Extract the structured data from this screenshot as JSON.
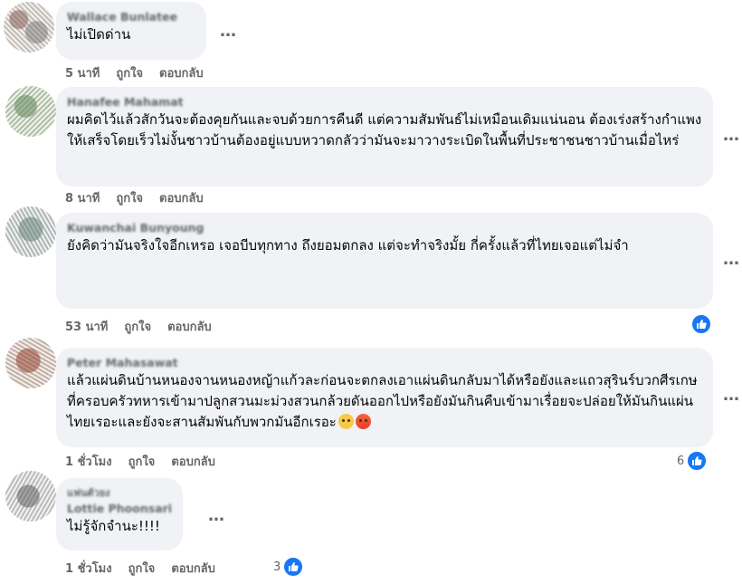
{
  "comments": [
    {
      "author": "Wallace Bunlatee",
      "text": "ไม่เปิดด่าน",
      "time": "5 นาที",
      "like_label": "ถูกใจ",
      "reply_label": "ตอบกลับ"
    },
    {
      "author": "Hanafee Mahamat",
      "text": "ผมคิดไว้แล้วสักวันจะต้องคุยกันและจบด้วยการคืนดี แต่ความสัมพันธ์ไม่เหมือนเดิมแน่นอน ต้องเร่งสร้างกำแพงให้เสร็จโดยเร็วไม่งั้นชาวบ้านต้องอยู่แบบหวาดกลัวว่ามันจะมาวางระเบิดในพื้นที่ประชาชนชาวบ้านเมื่อไหร่",
      "time": "8 นาที",
      "like_label": "ถูกใจ",
      "reply_label": "ตอบกลับ"
    },
    {
      "author": "Kuwanchai Bunyoung",
      "text": "ยังคิดว่ามันจริงใจอีกเหรอ เจอบีบทุกทาง ถึงยอมตกลง แต่จะทำจริงมั้ย กี่ครั้งแล้วที่ไทยเจอแต่ไม่จำ",
      "time": "53 นาที",
      "like_label": "ถูกใจ",
      "reply_label": "ตอบกลับ"
    },
    {
      "author": "Peter Mahasawat",
      "text": "แล้วแผ่นดินบ้านหนองจานหนองหญ้าแก้วละก่อนจะตกลงเอาแผ่นดินกลับมาได้หรือยังและแถวสุรินร์บวกศีรเกษที่ครอบครัวทหารเข้ามาปลูกสวนมะม่วงสวนกล้วยดันออกไปหรือยังมันกินคืบเข้ามาเรื่อยจะปล่อยให้มันกินแผ่นไทยเรอะและยังจะสานสัมพันกับพวกมันอีกเรอะ",
      "emojis": [
        "eye-roll-emoji",
        "angry-face-emoji"
      ],
      "time": "1 ชั่วโมง",
      "like_label": "ถูกใจ",
      "reply_label": "ตอบกลับ",
      "reactions": "6"
    },
    {
      "badge": "แฟนตัวยง",
      "author": "Lottie Phoonsarin",
      "text": "ไม่รู้จักจำนะ!!!!",
      "time": "1 ชั่วโมง",
      "like_label": "ถูกใจ",
      "reply_label": "ตอบกลับ",
      "reactions": "3"
    }
  ],
  "more_icon": "…",
  "colors": {
    "bubble": "#f0f2f5",
    "meta": "#65676b",
    "like_blue": "#1877f2"
  }
}
